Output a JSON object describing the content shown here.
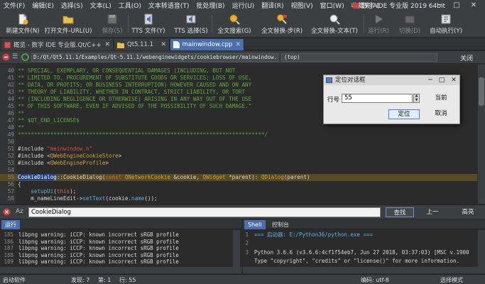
{
  "menubar": {
    "items": [
      "文件(F)",
      "编辑(E)",
      "选择(S)",
      "文本(L)",
      "工具(O)",
      "文本转语音(T)",
      "批处理(B)",
      "运行(U)",
      "翻译(R)",
      "视图(V)",
      "窗口(W)",
      "收藏夹(A)"
    ],
    "app_title": "数字 IDE 专业版 2019 64bit",
    "win_buttons": [
      "─",
      "□",
      "✕"
    ]
  },
  "toolbar": {
    "tools": [
      {
        "label": "新建文件(N)",
        "icon": "new-file-icon",
        "enabled": true
      },
      {
        "label": "打开文件-URL(U)",
        "icon": "open-folder-icon",
        "enabled": true
      },
      {
        "label": "保存(S)",
        "icon": "save-icon",
        "enabled": false
      },
      {
        "label": "TTS 文件(Y)",
        "icon": "tts-file-icon",
        "enabled": true
      },
      {
        "label": "TTS 选择(S)",
        "icon": "tts-select-icon",
        "enabled": true
      },
      {
        "label": "全文搜索(G)",
        "icon": "search-all-icon",
        "enabled": true
      },
      {
        "label": "全文替换-步(R)",
        "icon": "replace-step-icon",
        "enabled": true
      },
      {
        "label": "全文替换-文本(T)",
        "icon": "replace-text-icon",
        "enabled": true
      },
      {
        "label": "运行(R)",
        "icon": "run-icon",
        "enabled": false
      },
      {
        "label": "切换(D)",
        "icon": "switch-icon",
        "enabled": false
      },
      {
        "label": "自动执行(Y)",
        "icon": "auto-run-icon",
        "enabled": true
      }
    ]
  },
  "tabs": [
    {
      "label": "概览 - 数字 IDE 专业版.Qt/C++",
      "icon": "overview-icon",
      "active": false
    },
    {
      "label": "Qt5.11.1",
      "icon": "folder-icon",
      "active": false
    },
    {
      "label": "mainwindow.cpp",
      "icon": "cpp-file-icon",
      "active": true
    }
  ],
  "pathbar": {
    "path": "D:/Qt/Qt5.11.1/Examples/Qt-5.11.1/webenginewidgets/cookiebrowser/mainwindow.cpp",
    "func": "(top)",
    "close_label": "关闭"
  },
  "editor": {
    "lines": [
      {
        "n": "40",
        "segs": [
          {
            "c": "c-comment",
            "t": "** SPECIAL, EXEMPLARY, OR CONSEQUENTIAL DAMAGES (INCLUDING, BUT NOT"
          }
        ]
      },
      {
        "n": "41",
        "segs": [
          {
            "c": "c-comment",
            "t": "** LIMITED TO, PROCUREMENT OF SUBSTITUTE GOODS OR SERVICES; LOSS OF USE,"
          }
        ]
      },
      {
        "n": "42",
        "segs": [
          {
            "c": "c-comment",
            "t": "** DATA, OR PROFITS; OR BUSINESS INTERRUPTION) HOWEVER CAUSED AND ON ANY"
          }
        ]
      },
      {
        "n": "43",
        "segs": [
          {
            "c": "c-comment",
            "t": "** THEORY OF LIABILITY, WHETHER IN CONTRACT, STRICT LIABILITY, OR TORT"
          }
        ]
      },
      {
        "n": "44",
        "segs": [
          {
            "c": "c-comment",
            "t": "** (INCLUDING NEGLIGENCE OR OTHERWISE) ARISING IN ANY WAY OUT OF THE USE"
          }
        ]
      },
      {
        "n": "45",
        "segs": [
          {
            "c": "c-comment",
            "t": "** OF THIS SOFTWARE, EVEN IF ADVISED OF THE POSSIBILITY OF SUCH DAMAGE.\""
          }
        ]
      },
      {
        "n": "46",
        "segs": [
          {
            "c": "c-comment",
            "t": "**"
          }
        ]
      },
      {
        "n": "47",
        "segs": [
          {
            "c": "c-comment",
            "t": "** $QT_END_LICENSE$"
          }
        ]
      },
      {
        "n": "48",
        "segs": [
          {
            "c": "c-comment",
            "t": "**"
          }
        ]
      },
      {
        "n": "49",
        "segs": [
          {
            "c": "c-comment",
            "t": "****************************************************************************/"
          }
        ]
      },
      {
        "n": "50",
        "segs": [
          {
            "c": "c-plain",
            "t": ""
          }
        ]
      },
      {
        "n": "51",
        "segs": [
          {
            "c": "c-inc",
            "t": "#include "
          },
          {
            "c": "c-str",
            "t": "\"mainwindow.h\""
          }
        ]
      },
      {
        "n": "52",
        "segs": [
          {
            "c": "c-inc",
            "t": "#include <"
          },
          {
            "c": "c-type",
            "t": "QWebEngineCookieStore"
          },
          {
            "c": "c-inc",
            "t": ">"
          }
        ]
      },
      {
        "n": "53",
        "segs": [
          {
            "c": "c-inc",
            "t": "#include <"
          },
          {
            "c": "c-type",
            "t": "QWebEngineProfile"
          },
          {
            "c": "c-inc",
            "t": ">"
          }
        ]
      },
      {
        "n": "54",
        "segs": [
          {
            "c": "c-plain",
            "t": ""
          }
        ]
      },
      {
        "n": "55",
        "hl": true,
        "segs": [
          {
            "c": "c-sel",
            "t": "CookieDialog"
          },
          {
            "c": "c-plain",
            "t": "::CookieDialog("
          },
          {
            "c": "c-kw",
            "t": "const "
          },
          {
            "c": "c-type",
            "t": "QNetworkCookie"
          },
          {
            "c": "c-plain",
            "t": " &cookie, "
          },
          {
            "c": "c-type",
            "t": "QWidget"
          },
          {
            "c": "c-plain",
            "t": " *parent): "
          },
          {
            "c": "c-type",
            "t": "QDialog"
          },
          {
            "c": "c-plain",
            "t": "(parent)"
          }
        ]
      },
      {
        "n": "56",
        "segs": [
          {
            "c": "c-plain",
            "t": "{"
          }
        ]
      },
      {
        "n": "57",
        "segs": [
          {
            "c": "c-plain",
            "t": "    "
          },
          {
            "c": "c-func",
            "t": "setupUi"
          },
          {
            "c": "c-plain",
            "t": "("
          },
          {
            "c": "c-kw",
            "t": "this"
          },
          {
            "c": "c-plain",
            "t": ");"
          }
        ]
      },
      {
        "n": "58",
        "segs": [
          {
            "c": "c-plain",
            "t": "    m_nameLineEdit->"
          },
          {
            "c": "c-func",
            "t": "setText"
          },
          {
            "c": "c-plain",
            "t": "(cookie."
          },
          {
            "c": "c-func",
            "t": "name"
          },
          {
            "c": "c-plain",
            "t": "());"
          }
        ]
      }
    ]
  },
  "findbar": {
    "value": "CookieDialog",
    "find_label": "查找",
    "prev_label": "上一",
    "highlight_label": "高亮"
  },
  "run_pane": {
    "tab_label": "运行",
    "lines": [
      {
        "n": "185",
        "t": "libpng warning: iCCP: known incorrect sRGB profile"
      },
      {
        "n": "186",
        "t": "libpng warning: iCCP: known incorrect sRGB profile"
      },
      {
        "n": "187",
        "t": "libpng warning: iCCP: known incorrect sRGB profile"
      },
      {
        "n": "188",
        "t": "libpng warning: iCCP: known incorrect sRGB profile"
      },
      {
        "n": "189",
        "t": "libpng warning: iCCP: known incorrect sRGB profile"
      }
    ]
  },
  "shell_pane": {
    "tabs": [
      "Shell",
      "控制台"
    ],
    "lines": [
      {
        "n": "1",
        "t": "=== 启动器: E:/Python36/python.exe ===",
        "color": "#5fb0e0"
      },
      {
        "n": "2",
        "t": "",
        "color": "#d8d8d8"
      },
      {
        "n": "3",
        "t": "Python 3.6.6 (v3.6.6:4cf1f54eb7, Jun 27 2018, 03:37:03) [MSC v.1900",
        "color": "#d8d8d8"
      },
      {
        "n": "",
        "t": "Type \"copyright\", \"credits\" or \"license()\" for more information.",
        "color": "#d8d8d8"
      }
    ]
  },
  "statusbar": {
    "app": "启动软件",
    "found": "发现: 7",
    "row": "第: 1",
    "col": "行: 55",
    "encoding": "编码: utf-8",
    "mode": "选择模式"
  }
}
